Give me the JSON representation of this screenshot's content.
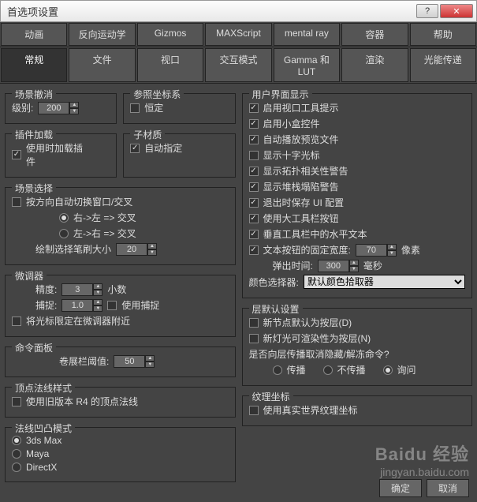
{
  "window": {
    "title": "首选项设置",
    "help": "?",
    "close": "✕"
  },
  "tabs_row1": [
    "动画",
    "反向运动学",
    "Gizmos",
    "MAXScript",
    "mental ray",
    "容器",
    "帮助"
  ],
  "tabs_row2": [
    "常规",
    "文件",
    "视口",
    "交互模式",
    "Gamma 和 LUT",
    "渲染",
    "光能传递"
  ],
  "active_tab": "常规",
  "left": {
    "scene_undo": {
      "title": "场景撤消",
      "level_label": "级别:",
      "level_value": "200"
    },
    "ref_coord": {
      "title": "参照坐标系",
      "constant": "恒定"
    },
    "plugin_load": {
      "title": "插件加载",
      "load_on_use": "使用时加载插件"
    },
    "sub_mtl": {
      "title": "子材质",
      "auto_assign": "自动指定"
    },
    "scene_sel": {
      "title": "场景选择",
      "auto_switch": "按方向自动切换窗口/交叉",
      "r2l": "右->左 => 交叉",
      "l2r": "左->右 => 交叉",
      "brush_label": "绘制选择笔刷大小",
      "brush_value": "20"
    },
    "spinners": {
      "title": "微调器",
      "precision_label": "精度:",
      "precision_value": "3",
      "decimals": "小数",
      "snap_label": "捕捉:",
      "snap_value": "1.0",
      "use_snap": "使用捕捉",
      "lock_near": "将光标限定在微调器附近"
    },
    "cmd_panel": {
      "title": "命令面板",
      "rollup_label": "卷展栏阈值:",
      "rollup_value": "50"
    },
    "vertex_normal": {
      "title": "顶点法线样式",
      "use_r4": "使用旧版本 R4 的顶点法线"
    },
    "normal_bump": {
      "title": "法线凹凸模式",
      "opt1": "3ds Max",
      "opt2": "Maya",
      "opt3": "DirectX"
    }
  },
  "right": {
    "ui_display": {
      "title": "用户界面显示",
      "items": [
        "启用视口工具提示",
        "启用小盒控件",
        "自动播放预览文件",
        "显示十字光标",
        "显示拓扑相关性警告",
        "显示堆栈塌陷警告",
        "退出时保存 UI 配置",
        "使用大工具栏按钮",
        "垂直工具栏中的水平文本",
        "文本按钮的固定宽度:"
      ],
      "checked": [
        true,
        true,
        true,
        false,
        true,
        true,
        true,
        true,
        true,
        true
      ],
      "fixed_width_value": "70",
      "px": "像素",
      "popup_label": "弹出时间:",
      "popup_value": "300",
      "ms": "毫秒",
      "color_picker_label": "颜色选择器:",
      "color_picker_value": "默认颜色拾取器"
    },
    "layer_defaults": {
      "title": "层默认设置",
      "new_node": "新节点默认为按层(D)",
      "new_light": "新灯光可渲染性为按层(N)",
      "question": "是否向层传播取消隐藏/解冻命令?",
      "opt1": "传播",
      "opt2": "不传播",
      "opt3": "询问"
    },
    "tex_coord": {
      "title": "纹理坐标",
      "use_real": "使用真实世界纹理坐标"
    }
  },
  "buttons": {
    "ok": "确定",
    "cancel": "取消"
  },
  "watermark": {
    "brand": "Baidu 经验",
    "url": "jingyan.baidu.com"
  }
}
